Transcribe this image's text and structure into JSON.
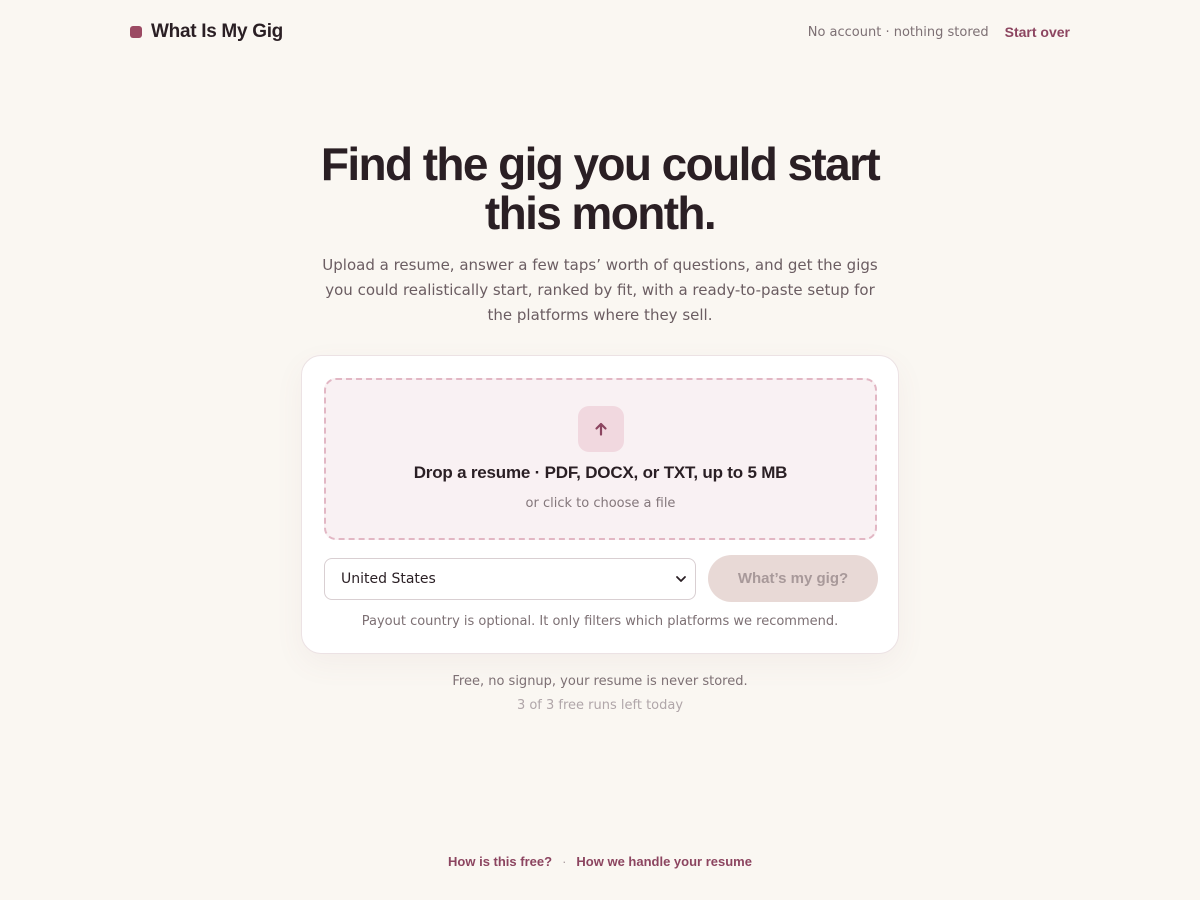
{
  "header": {
    "brand_name": "What Is My Gig",
    "privacy_note": "No account · nothing stored",
    "start_over_label": "Start over"
  },
  "hero": {
    "title": "Find the gig you could start this month.",
    "subtitle": "Upload a resume, answer a few taps’ worth of questions, and get the gigs you could realistically start, ranked by fit, with a ready-to-paste setup for the platforms where they sell."
  },
  "upload": {
    "icon": "arrow-up-icon",
    "title": "Drop a resume · PDF, DOCX, or TXT, up to 5 MB",
    "subtitle": "or click to choose a file"
  },
  "form": {
    "country_selected": "United States",
    "submit_label": "What’s my gig?",
    "payout_note": "Payout country is optional. It only filters which platforms we recommend."
  },
  "notes": {
    "free_note": "Free, no signup, your resume is never stored.",
    "runs_left": "3 of 3 free runs left today"
  },
  "footer": {
    "link_free": "How is this free?",
    "separator": "·",
    "link_resume": "How we handle your resume"
  },
  "colors": {
    "background": "#faf7f2",
    "accent": "#9b4a63",
    "link": "#8c4560",
    "dropzone_bg": "#f9f1f3",
    "dropzone_border": "#e2b7c4",
    "button_disabled_bg": "#e8d9d6",
    "button_disabled_text": "#a8999a"
  }
}
